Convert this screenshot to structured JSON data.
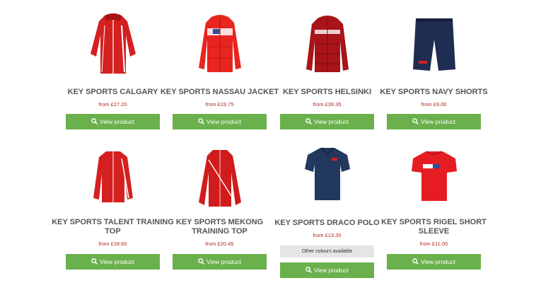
{
  "products": [
    {
      "name": "KEY SPORTS CALGARY",
      "price": "from £27.20",
      "button": "View product",
      "icon": "red-jacket-icon"
    },
    {
      "name": "KEY SPORTS NASSAU JACKET",
      "price": "from £19.75",
      "button": "View product",
      "icon": "red-padded-jacket-icon"
    },
    {
      "name": "KEY SPORTS HELSINKI",
      "price": "from £39.35",
      "button": "View product",
      "icon": "dark-red-puffer-icon"
    },
    {
      "name": "KEY SPORTS NAVY SHORTS",
      "price": "from £9.00",
      "button": "View product",
      "icon": "navy-shorts-icon"
    },
    {
      "name": "KEY SPORTS TALENT TRAINING TOP",
      "price": "from £18.60",
      "button": "View product",
      "icon": "red-track-top-icon"
    },
    {
      "name": "KEY SPORTS MEKONG TRAINING TOP",
      "price": "from £20.45",
      "button": "View product",
      "icon": "red-training-top-icon"
    },
    {
      "name": "KEY SPORTS DRACO POLO",
      "price": "from £13.30",
      "button": "View product",
      "badge": "Other colours available",
      "icon": "navy-polo-icon"
    },
    {
      "name": "KEY SPORTS RIGEL SHORT SLEEVE",
      "price": "from £11.00",
      "button": "View product",
      "icon": "red-tshirt-icon"
    }
  ],
  "colors": {
    "button": "#6ab04c",
    "price": "#b0281e",
    "name": "#555555"
  }
}
